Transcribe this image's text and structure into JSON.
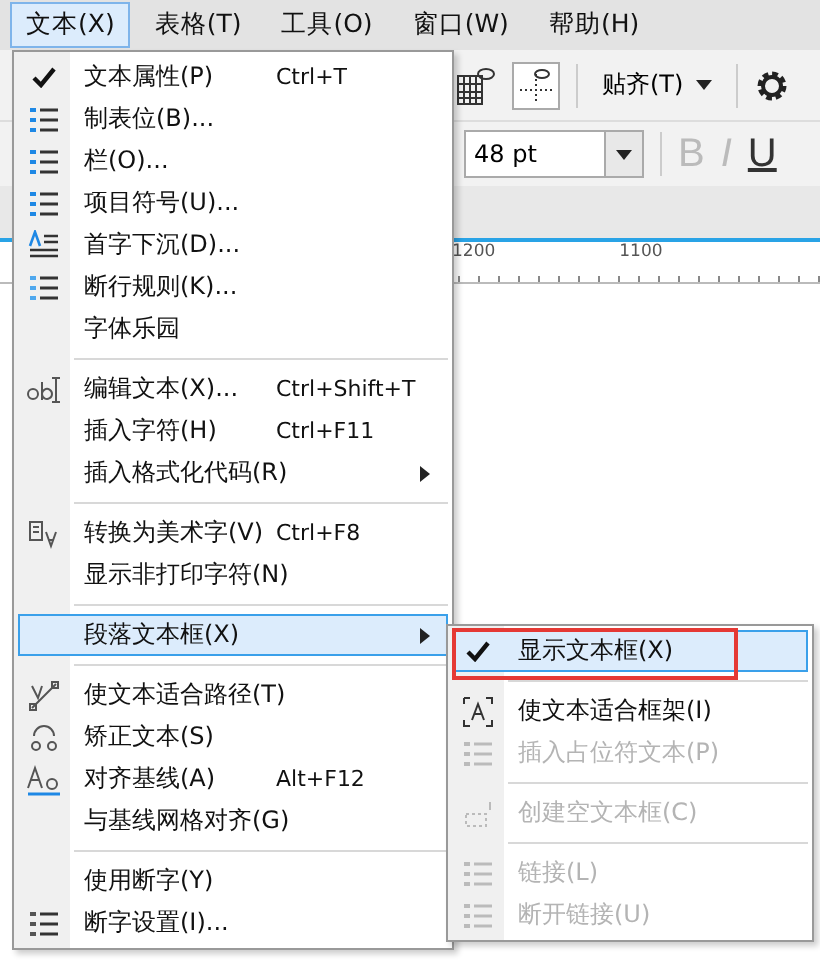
{
  "menubar": [
    {
      "label": "文本(X)",
      "selected": true
    },
    {
      "label": "表格(T)",
      "selected": false
    },
    {
      "label": "工具(O)",
      "selected": false
    },
    {
      "label": "窗口(W)",
      "selected": false
    },
    {
      "label": "帮助(H)",
      "selected": false
    }
  ],
  "toolbar": {
    "snap_label": "贴齐(T)"
  },
  "property_bar": {
    "font_size": "48 pt",
    "bold": "B",
    "italic": "I",
    "underline": "U"
  },
  "ruler": {
    "labels": [
      "1200",
      "1100"
    ]
  },
  "menu": [
    {
      "kind": "item",
      "label": "文本属性(P)",
      "shortcut": "Ctrl+T",
      "checked": true,
      "selected": false,
      "disabled": false
    },
    {
      "kind": "item",
      "label": "制表位(B)...",
      "checked": false,
      "selected": false,
      "disabled": false
    },
    {
      "kind": "item",
      "label": "栏(O)...",
      "checked": false,
      "selected": false,
      "disabled": false
    },
    {
      "kind": "item",
      "label": "项目符号(U)...",
      "checked": false,
      "selected": false,
      "disabled": false
    },
    {
      "kind": "item",
      "label": "首字下沉(D)...",
      "checked": false,
      "selected": false,
      "disabled": false
    },
    {
      "kind": "item",
      "label": "断行规则(K)...",
      "checked": false,
      "selected": false,
      "disabled": false
    },
    {
      "kind": "item",
      "label": "字体乐园",
      "checked": false,
      "selected": false,
      "disabled": false
    },
    {
      "kind": "separator"
    },
    {
      "kind": "item",
      "label": "编辑文本(X)...",
      "shortcut": "Ctrl+Shift+T",
      "checked": false,
      "selected": false,
      "disabled": false
    },
    {
      "kind": "item",
      "label": "插入字符(H)",
      "shortcut": "Ctrl+F11",
      "checked": false,
      "selected": false,
      "disabled": false
    },
    {
      "kind": "item",
      "label": "插入格式化代码(R)",
      "submenu": true,
      "checked": false,
      "selected": false,
      "disabled": false
    },
    {
      "kind": "separator"
    },
    {
      "kind": "item",
      "label": "转换为美术字(V)",
      "shortcut": "Ctrl+F8",
      "checked": false,
      "selected": false,
      "disabled": false
    },
    {
      "kind": "item",
      "label": "显示非打印字符(N)",
      "checked": false,
      "selected": false,
      "disabled": false
    },
    {
      "kind": "separator"
    },
    {
      "kind": "item",
      "label": "段落文本框(X)",
      "submenu": true,
      "checked": false,
      "selected": true,
      "disabled": false
    },
    {
      "kind": "separator"
    },
    {
      "kind": "item",
      "label": "使文本适合路径(T)",
      "checked": false,
      "selected": false,
      "disabled": false
    },
    {
      "kind": "item",
      "label": "矫正文本(S)",
      "checked": false,
      "selected": false,
      "disabled": false
    },
    {
      "kind": "item",
      "label": "对齐基线(A)",
      "shortcut": "Alt+F12",
      "checked": false,
      "selected": false,
      "disabled": false
    },
    {
      "kind": "item",
      "label": "与基线网格对齐(G)",
      "checked": false,
      "selected": false,
      "disabled": false
    },
    {
      "kind": "separator"
    },
    {
      "kind": "item",
      "label": "使用断字(Y)",
      "checked": false,
      "selected": false,
      "disabled": false
    },
    {
      "kind": "item",
      "label": "断字设置(I)...",
      "checked": false,
      "selected": false,
      "disabled": false
    }
  ],
  "submenu": [
    {
      "kind": "item",
      "label": "显示文本框(X)",
      "checked": true,
      "selected": true,
      "disabled": false
    },
    {
      "kind": "separator"
    },
    {
      "kind": "item",
      "label": "使文本适合框架(I)",
      "checked": false,
      "selected": false,
      "disabled": false
    },
    {
      "kind": "item",
      "label": "插入占位符文本(P)",
      "checked": false,
      "selected": false,
      "disabled": true
    },
    {
      "kind": "separator"
    },
    {
      "kind": "item",
      "label": "创建空文本框(C)",
      "checked": false,
      "selected": false,
      "disabled": true
    },
    {
      "kind": "separator"
    },
    {
      "kind": "item",
      "label": "链接(L)",
      "checked": false,
      "selected": false,
      "disabled": true
    },
    {
      "kind": "item",
      "label": "断开链接(U)",
      "checked": false,
      "selected": false,
      "disabled": true
    }
  ]
}
